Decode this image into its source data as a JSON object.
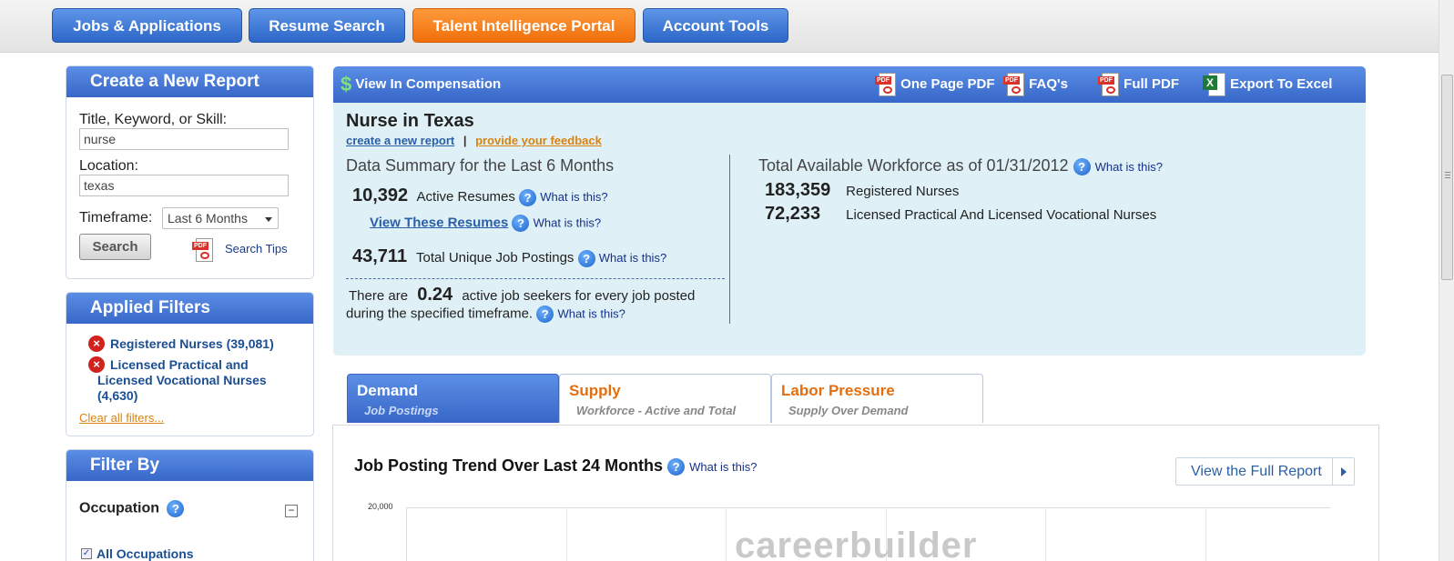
{
  "nav": {
    "items": [
      "Jobs & Applications",
      "Resume Search",
      "Talent Intelligence Portal",
      "Account Tools"
    ]
  },
  "create_report": {
    "title": "Create a New Report",
    "keyword_label": "Title, Keyword, or Skill:",
    "keyword_value": "nurse",
    "location_label": "Location:",
    "location_value": "texas",
    "timeframe_label": "Timeframe:",
    "timeframe_value": "Last 6 Months",
    "search_button": "Search",
    "search_tips": "Search Tips"
  },
  "applied_filters": {
    "title": "Applied Filters",
    "items": [
      "Registered Nurses (39,081)",
      "Licensed Practical and Licensed Vocational Nurses (4,630)"
    ],
    "clear_all": "Clear all filters..."
  },
  "filter_by": {
    "title": "Filter By",
    "occupation_label": "Occupation",
    "all_occupations": "All Occupations",
    "collapse_symbol": "−"
  },
  "report_header": {
    "view_in": "View In Compensation",
    "one_page_pdf": "One Page PDF",
    "faqs": "FAQ's",
    "full_pdf": "Full PDF",
    "export_excel": "Export To Excel"
  },
  "report": {
    "title": "Nurse in Texas",
    "create_link": "create a new report",
    "separator": "|",
    "feedback_link": "provide your feedback",
    "summary_heading": "Data Summary for the Last 6 Months",
    "active_resumes_value": "10,392",
    "active_resumes_label": "Active Resumes",
    "view_resumes": "View These Resumes",
    "job_postings_value": "43,711",
    "job_postings_label": "Total Unique Job Postings",
    "ratio_pre": "There are",
    "ratio_value": "0.24",
    "ratio_post": "active job seekers for every job posted",
    "ratio_line2": "during the specified timeframe.",
    "workforce_heading": "Total Available Workforce as of 01/31/2012",
    "workforce": [
      {
        "value": "183,359",
        "label": "Registered Nurses"
      },
      {
        "value": "72,233",
        "label": "Licensed Practical And Licensed Vocational Nurses"
      }
    ],
    "what_is_this": "What is this?"
  },
  "tabs": [
    {
      "title": "Demand",
      "subtitle": "Job Postings"
    },
    {
      "title": "Supply",
      "subtitle": "Workforce - Active and Total"
    },
    {
      "title": "Labor Pressure",
      "subtitle": "Supply Over Demand"
    }
  ],
  "chart": {
    "title": "Job Posting Trend Over Last 24 Months",
    "full_report": "View the Full Report",
    "y_top_label": "20,000",
    "watermark": "careerbuilder"
  },
  "colors": {
    "nav_blue": "#3a73d6",
    "nav_orange": "#f27b15",
    "panel_blue": "#4a7bd9",
    "info_bg": "#dff1f7",
    "link_orange": "#d9820e"
  }
}
